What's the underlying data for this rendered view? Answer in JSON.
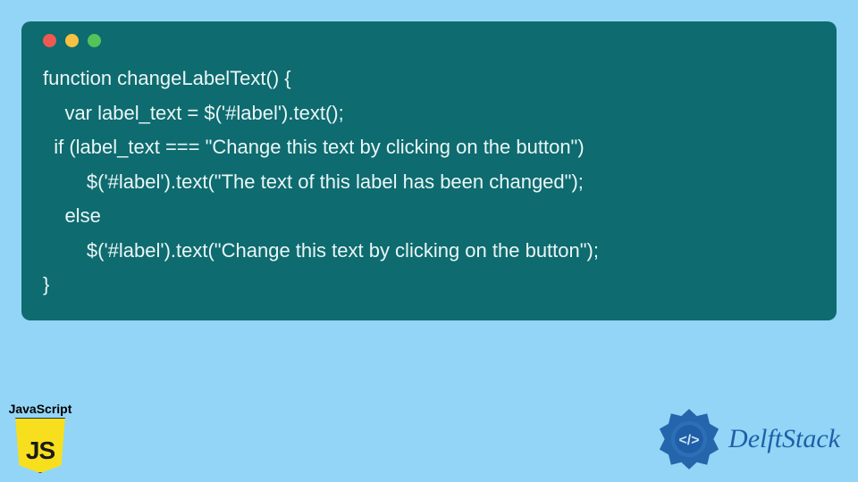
{
  "code": {
    "line1": "function changeLabelText() {",
    "line2": "    var label_text = $('#label').text();",
    "line3": "  if (label_text === \"Change this text by clicking on the button\")",
    "line4": "        $('#label').text(\"The text of this label has been changed\");",
    "line5": "    else",
    "line6": "        $('#label').text(\"Change this text by clicking on the button\");",
    "line7": "}"
  },
  "badges": {
    "js_label": "JavaScript",
    "js_shield_text": "JS",
    "brand": "DelftStack"
  },
  "colors": {
    "bg": "#93d5f6",
    "panel": "#0e6b6f",
    "js_yellow": "#f7df1e",
    "brand_blue": "#1f5fa8"
  }
}
